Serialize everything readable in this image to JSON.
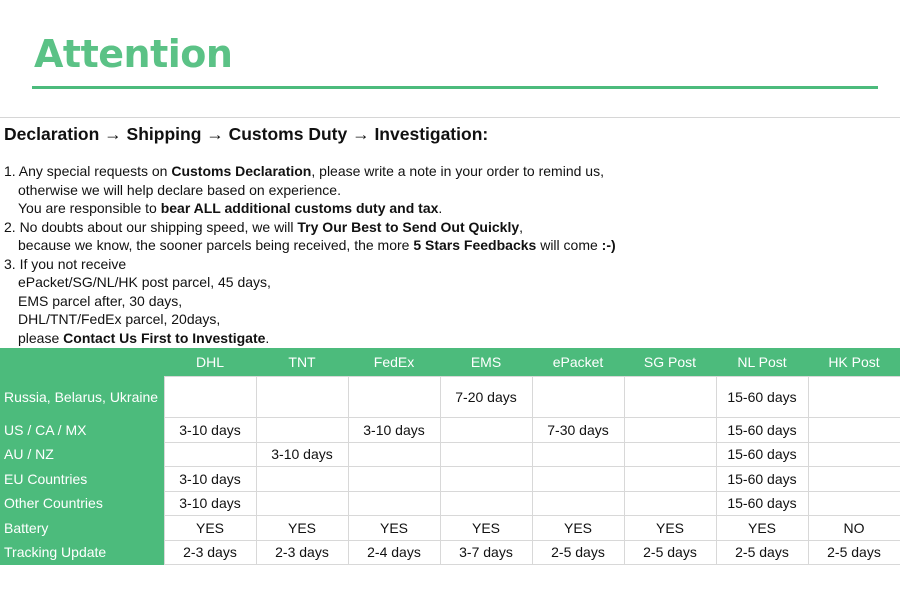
{
  "page": {
    "title": "Attention"
  },
  "policy": {
    "heading": "Declaration → Shipping →  Customs Duty → Investigation:",
    "lines": [
      {
        "parts": [
          {
            "t": "1. Any special requests on ",
            "b": false
          },
          {
            "t": "Customs Declaration",
            "b": true
          },
          {
            "t": ", please write a note in your order to remind us,",
            "b": false
          }
        ],
        "indent": false
      },
      {
        "parts": [
          {
            "t": "otherwise we will help declare based on experience.",
            "b": false
          }
        ],
        "indent": true
      },
      {
        "parts": [
          {
            "t": "You are responsible to ",
            "b": false
          },
          {
            "t": "bear ALL additional customs duty and tax",
            "b": true
          },
          {
            "t": ".",
            "b": false
          }
        ],
        "indent": true
      },
      {
        "parts": [
          {
            "t": "2. No doubts about our shipping speed, we will ",
            "b": false
          },
          {
            "t": "Try Our Best to Send Out Quickly",
            "b": true
          },
          {
            "t": ",",
            "b": false
          }
        ],
        "indent": false
      },
      {
        "parts": [
          {
            "t": "because we know, the sooner parcels being received, the more ",
            "b": false
          },
          {
            "t": "5 Stars Feedbacks",
            "b": true
          },
          {
            "t": " will come ",
            "b": false
          },
          {
            "t": ":-)",
            "b": true
          }
        ],
        "indent": true
      },
      {
        "parts": [
          {
            "t": "3. If you not receive",
            "b": false
          }
        ],
        "indent": false
      },
      {
        "parts": [
          {
            "t": "ePacket/SG/NL/HK post parcel, 45 days,",
            "b": false
          }
        ],
        "indent": true
      },
      {
        "parts": [
          {
            "t": "EMS parcel after, 30 days,",
            "b": false
          }
        ],
        "indent": true
      },
      {
        "parts": [
          {
            "t": "DHL/TNT/FedEx parcel, 20days,",
            "b": false
          }
        ],
        "indent": true
      },
      {
        "parts": [
          {
            "t": "please ",
            "b": false
          },
          {
            "t": "Contact Us First to Investigate",
            "b": true
          },
          {
            "t": ".",
            "b": false
          }
        ],
        "indent": true
      }
    ]
  },
  "table": {
    "columns": [
      "DHL",
      "TNT",
      "FedEx",
      "EMS",
      "ePacket",
      "SG Post",
      "NL Post",
      "HK Post"
    ],
    "rows": [
      {
        "label": "Russia, Belarus, Ukraine",
        "cells": [
          "",
          "",
          "",
          "7-20 days",
          "",
          "",
          "15-60 days",
          ""
        ]
      },
      {
        "label": "US / CA / MX",
        "cells": [
          "3-10 days",
          "",
          "3-10 days",
          "",
          "7-30 days",
          "",
          "15-60 days",
          ""
        ]
      },
      {
        "label": "AU / NZ",
        "cells": [
          "",
          "3-10 days",
          "",
          "",
          "",
          "",
          "15-60 days",
          ""
        ]
      },
      {
        "label": "EU Countries",
        "cells": [
          "3-10 days",
          "",
          "",
          "",
          "",
          "",
          "15-60 days",
          ""
        ]
      },
      {
        "label": "Other Countries",
        "cells": [
          "3-10 days",
          "",
          "",
          "",
          "",
          "",
          "15-60 days",
          ""
        ]
      },
      {
        "label": "Battery",
        "cells": [
          "YES",
          "YES",
          "YES",
          "YES",
          "YES",
          "YES",
          "YES",
          "NO"
        ]
      },
      {
        "label": "Tracking Update",
        "cells": [
          "2-3 days",
          "2-3 days",
          "2-4 days",
          "3-7 days",
          "2-5 days",
          "2-5 days",
          "2-5 days",
          "2-5 days"
        ]
      }
    ]
  },
  "colors": {
    "accent": "#4cbb7c",
    "title": "#5bc286"
  }
}
